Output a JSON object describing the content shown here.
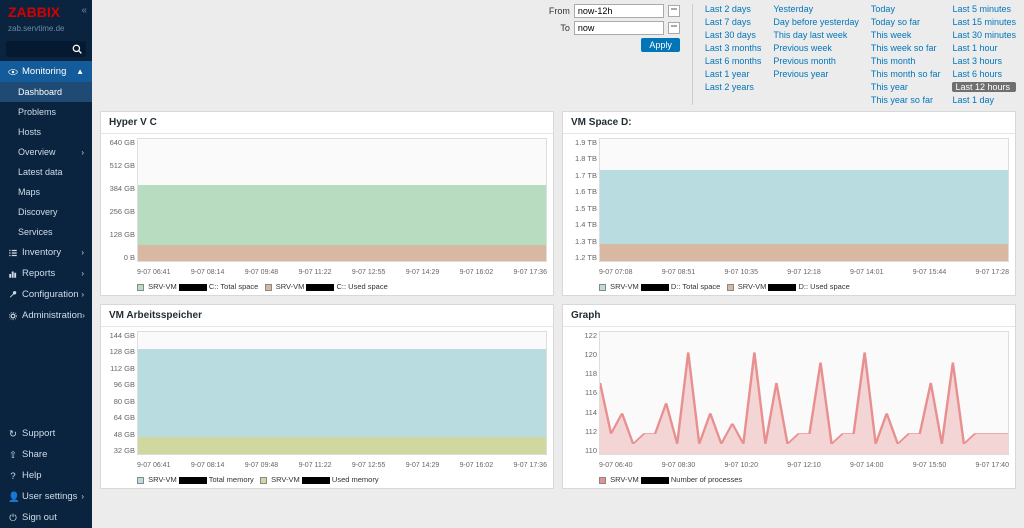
{
  "app": {
    "name": "ZABBIX",
    "host": "zab.servtime.de"
  },
  "sidebar": {
    "sections": [
      {
        "label": "Monitoring",
        "active": true
      },
      {
        "label": "Inventory",
        "active": false
      },
      {
        "label": "Reports",
        "active": false
      },
      {
        "label": "Configuration",
        "active": false
      },
      {
        "label": "Administration",
        "active": false
      }
    ],
    "monitoring_items": [
      {
        "label": "Dashboard",
        "selected": true
      },
      {
        "label": "Problems",
        "selected": false
      },
      {
        "label": "Hosts",
        "selected": false
      },
      {
        "label": "Overview",
        "selected": false
      },
      {
        "label": "Latest data",
        "selected": false
      },
      {
        "label": "Maps",
        "selected": false
      },
      {
        "label": "Discovery",
        "selected": false
      },
      {
        "label": "Services",
        "selected": false
      }
    ],
    "bottom": [
      {
        "label": "Support"
      },
      {
        "label": "Share"
      },
      {
        "label": "Help"
      },
      {
        "label": "User settings"
      },
      {
        "label": "Sign out"
      }
    ]
  },
  "time": {
    "from_label": "From",
    "from_value": "now-12h",
    "to_label": "To",
    "to_value": "now",
    "apply": "Apply"
  },
  "presets": {
    "col1": [
      "Last 2 days",
      "Last 7 days",
      "Last 30 days",
      "Last 3 months",
      "Last 6 months",
      "Last 1 year",
      "Last 2 years"
    ],
    "col2": [
      "Yesterday",
      "Day before yesterday",
      "This day last week",
      "Previous week",
      "Previous month",
      "Previous year"
    ],
    "col3": [
      "Today",
      "Today so far",
      "This week",
      "This week so far",
      "This month",
      "This month so far",
      "This year",
      "This year so far"
    ],
    "col4": [
      "Last 5 minutes",
      "Last 15 minutes",
      "Last 30 minutes",
      "Last 1 hour",
      "Last 3 hours",
      "Last 6 hours",
      "Last 12 hours",
      "Last 1 day"
    ],
    "selected": "Last 12 hours"
  },
  "panels": [
    {
      "title": "Hyper V C",
      "yticks": [
        "640 GB",
        "512 GB",
        "384 GB",
        "256 GB",
        "128 GB",
        "0 B"
      ],
      "xticks": [
        "9-07 06:41",
        "9-07 08:14",
        "9-07 09:48",
        "9-07 11:22",
        "9-07 12:55",
        "9-07 14:29",
        "9-07 16:02",
        "9-07 17:36"
      ],
      "legend_total": "C:: Total space",
      "legend_used": "C:: Used space",
      "host_prefix": "SRV-VM",
      "total_color": "#b8dcc0",
      "used_color": "#d8b8a0"
    },
    {
      "title": "VM Space D:",
      "yticks": [
        "1.9 TB",
        "1.8 TB",
        "1.7 TB",
        "1.6 TB",
        "1.5 TB",
        "1.4 TB",
        "1.3 TB",
        "1.2 TB"
      ],
      "xticks": [
        "9-07 07:08",
        "9-07 08:51",
        "9-07 10:35",
        "9-07 12:18",
        "9-07 14:01",
        "9-07 15:44",
        "9-07 17:28"
      ],
      "legend_total": "D:: Total space",
      "legend_used": "D:: Used space",
      "host_prefix": "SRV-VM",
      "total_color": "#b8dce0",
      "used_color": "#d8b8a0"
    },
    {
      "title": "VM Arbeitsspeicher",
      "yticks": [
        "144 GB",
        "128 GB",
        "112 GB",
        "96 GB",
        "80 GB",
        "64 GB",
        "48 GB",
        "32 GB"
      ],
      "xticks": [
        "9-07 06:41",
        "9-07 08:14",
        "9-07 09:48",
        "9-07 11:22",
        "9-07 12:55",
        "9-07 14:29",
        "9-07 16:02",
        "9-07 17:36"
      ],
      "legend_total": "Total memory",
      "legend_used": "Used memory",
      "host_prefix": "SRV-VM",
      "total_color": "#b8dce0",
      "used_color": "#d0d8a0"
    },
    {
      "title": "Graph",
      "yticks": [
        "122",
        "120",
        "118",
        "116",
        "114",
        "112",
        "110"
      ],
      "xticks": [
        "9-07 06:40",
        "9-07 08:30",
        "9-07 10:20",
        "9-07 12:10",
        "9-07 14:00",
        "9-07 15:50",
        "9-07 17:40"
      ],
      "legend_series": "Number of processes",
      "host_prefix": "SRV-VM",
      "line_color": "#e89090"
    }
  ],
  "chart_data": [
    {
      "type": "area",
      "title": "Hyper V C",
      "ylabel": "",
      "ylim": [
        0,
        640
      ],
      "yunit": "GB",
      "x": [
        "9-07 06:41",
        "9-07 08:14",
        "9-07 09:48",
        "9-07 11:22",
        "9-07 12:55",
        "9-07 14:29",
        "9-07 16:02",
        "9-07 17:36"
      ],
      "series": [
        {
          "name": "C:: Total space",
          "values": [
            400,
            400,
            400,
            400,
            400,
            400,
            400,
            400
          ]
        },
        {
          "name": "C:: Used space",
          "values": [
            85,
            85,
            85,
            85,
            85,
            85,
            85,
            85
          ]
        }
      ]
    },
    {
      "type": "area",
      "title": "VM Space D:",
      "ylabel": "",
      "ylim": [
        1.2,
        1.9
      ],
      "yunit": "TB",
      "x": [
        "9-07 07:08",
        "9-07 08:51",
        "9-07 10:35",
        "9-07 12:18",
        "9-07 14:01",
        "9-07 15:44",
        "9-07 17:28"
      ],
      "series": [
        {
          "name": "D:: Total space",
          "values": [
            1.72,
            1.72,
            1.72,
            1.72,
            1.72,
            1.72,
            1.72
          ]
        },
        {
          "name": "D:: Used space",
          "values": [
            1.3,
            1.3,
            1.3,
            1.3,
            1.3,
            1.3,
            1.3
          ]
        }
      ]
    },
    {
      "type": "area",
      "title": "VM Arbeitsspeicher",
      "ylabel": "",
      "ylim": [
        32,
        144
      ],
      "yunit": "GB",
      "x": [
        "9-07 06:41",
        "9-07 08:14",
        "9-07 09:48",
        "9-07 11:22",
        "9-07 12:55",
        "9-07 14:29",
        "9-07 16:02",
        "9-07 17:36"
      ],
      "series": [
        {
          "name": "Total memory",
          "values": [
            128,
            128,
            128,
            128,
            128,
            128,
            128,
            128
          ]
        },
        {
          "name": "Used memory",
          "values": [
            48,
            48,
            48,
            48,
            48,
            48,
            48,
            48
          ]
        }
      ]
    },
    {
      "type": "line",
      "title": "Graph",
      "ylabel": "",
      "ylim": [
        110,
        122
      ],
      "x": [
        "9-07 06:40",
        "9-07 08:30",
        "9-07 10:20",
        "9-07 12:10",
        "9-07 14:00",
        "9-07 15:50",
        "9-07 17:40"
      ],
      "series": [
        {
          "name": "Number of processes",
          "values": [
            117,
            112,
            114,
            111,
            112,
            112,
            115,
            111,
            120,
            111,
            114,
            111,
            113,
            111,
            120,
            111,
            117,
            111,
            112,
            112,
            119,
            111,
            112,
            112,
            120,
            111,
            114,
            111,
            112,
            112,
            117,
            111,
            119,
            111,
            112,
            112,
            112,
            112
          ]
        }
      ]
    }
  ]
}
